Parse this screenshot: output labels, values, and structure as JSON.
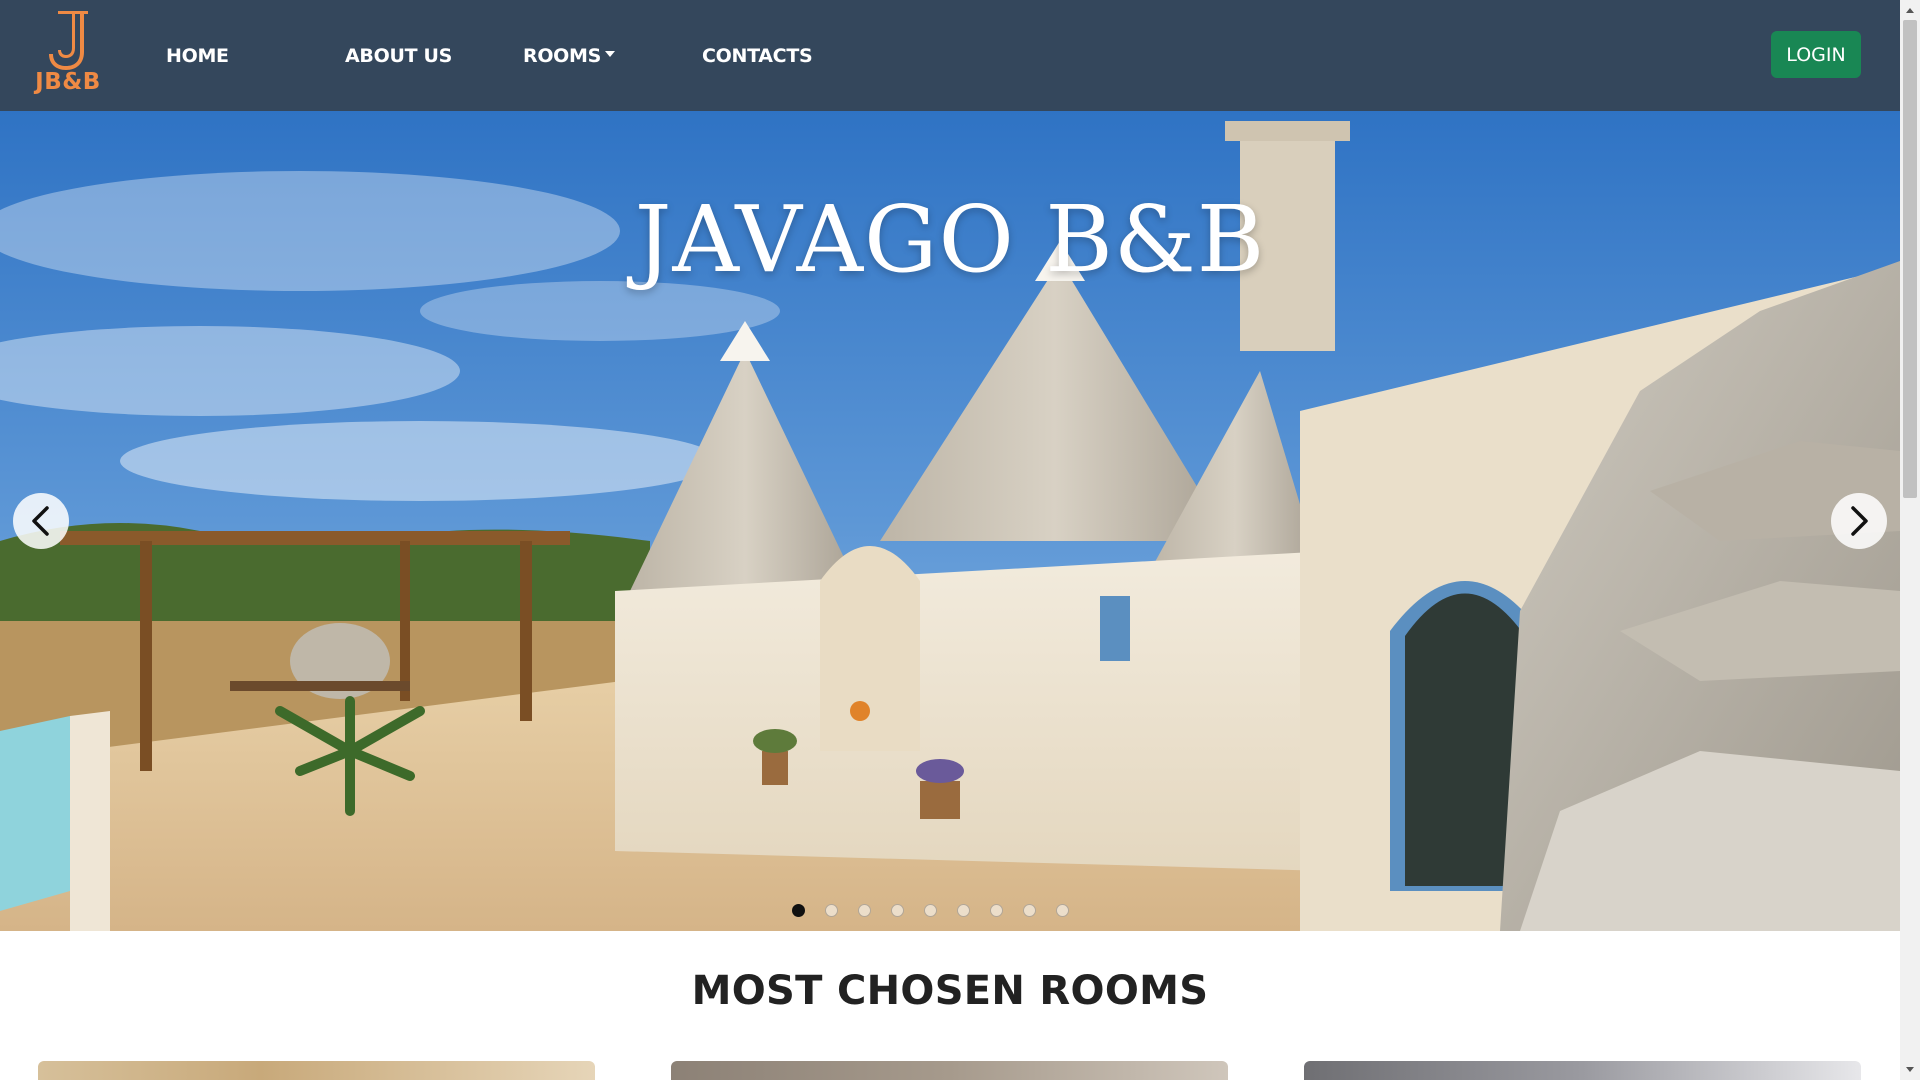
{
  "nav": {
    "logo_text": "JB&B",
    "items": [
      {
        "label": "HOME"
      },
      {
        "label": "ABOUT US"
      },
      {
        "label": "ROOMS"
      },
      {
        "label": "CONTACTS"
      }
    ],
    "login_label": "LOGIN"
  },
  "hero": {
    "title": "JAVAGO B&B",
    "slide_count": 9,
    "active_slide": 1
  },
  "section": {
    "title": "MOST CHOSEN ROOMS"
  },
  "colors": {
    "navbar": "#34475c",
    "logo": "#ef8a44",
    "login": "#198754"
  },
  "icons": {
    "prev": "chevron-left-icon",
    "next": "chevron-right-icon",
    "rooms_dropdown": "caret-down-icon"
  }
}
